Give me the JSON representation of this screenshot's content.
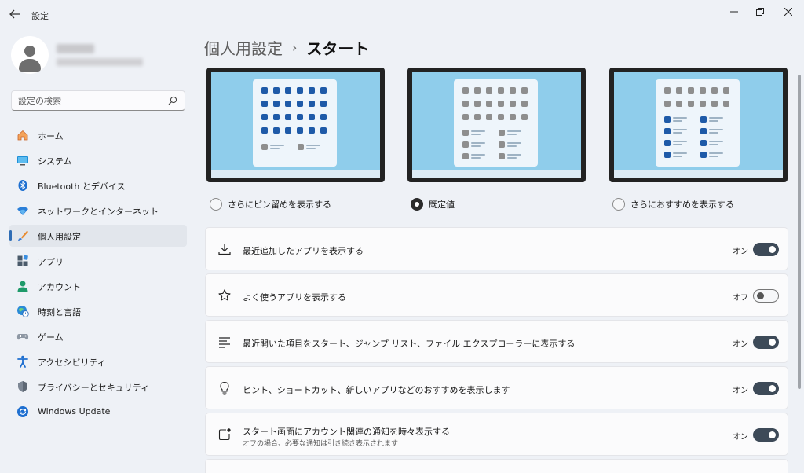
{
  "window": {
    "title": "設定",
    "controls": {
      "minimize": "—",
      "maximize": "❐",
      "close": "✕"
    }
  },
  "sidebar": {
    "search_placeholder": "設定の検索",
    "items": [
      {
        "label": "ホーム",
        "icon": "home-icon",
        "active": false
      },
      {
        "label": "システム",
        "icon": "system-icon",
        "active": false
      },
      {
        "label": "Bluetooth とデバイス",
        "icon": "bluetooth-icon",
        "active": false
      },
      {
        "label": "ネットワークとインターネット",
        "icon": "wifi-icon",
        "active": false
      },
      {
        "label": "個人用設定",
        "icon": "brush-icon",
        "active": true
      },
      {
        "label": "アプリ",
        "icon": "apps-icon",
        "active": false
      },
      {
        "label": "アカウント",
        "icon": "account-icon",
        "active": false
      },
      {
        "label": "時刻と言語",
        "icon": "globe-clock-icon",
        "active": false
      },
      {
        "label": "ゲーム",
        "icon": "gamepad-icon",
        "active": false
      },
      {
        "label": "アクセシビリティ",
        "icon": "accessibility-icon",
        "active": false
      },
      {
        "label": "プライバシーとセキュリティ",
        "icon": "shield-icon",
        "active": false
      },
      {
        "label": "Windows Update",
        "icon": "update-icon",
        "active": false
      }
    ]
  },
  "main": {
    "breadcrumb": {
      "parent": "個人用設定",
      "separator": "›",
      "current": "スタート"
    },
    "layout_options": [
      {
        "label": "さらにピン留めを表示する",
        "selected": false
      },
      {
        "label": "既定値",
        "selected": true
      },
      {
        "label": "さらにおすすめを表示する",
        "selected": false
      }
    ],
    "settings": [
      {
        "title": "最近追加したアプリを表示する",
        "subtitle": "",
        "state": "オン",
        "on": true,
        "icon": "download-icon"
      },
      {
        "title": "よく使うアプリを表示する",
        "subtitle": "",
        "state": "オフ",
        "on": false,
        "icon": "star-icon"
      },
      {
        "title": "最近開いた項目をスタート、ジャンプ リスト、ファイル エクスプローラーに表示する",
        "subtitle": "",
        "state": "オン",
        "on": true,
        "icon": "list-icon"
      },
      {
        "title": "ヒント、ショートカット、新しいアプリなどのおすすめを表示します",
        "subtitle": "",
        "state": "オン",
        "on": true,
        "icon": "lightbulb-icon"
      },
      {
        "title": "スタート画面にアカウント関連の通知を時々表示する",
        "subtitle": "オフの場合、必要な通知は引き続き表示されます",
        "state": "オン",
        "on": true,
        "icon": "notification-icon"
      }
    ]
  },
  "colors": {
    "accent": "#2f6db5",
    "toggle_on": "#3d4a58",
    "preview_bg": "#8fcdeb",
    "tile_gray": "#8e8e8e",
    "tile_blue": "#1e5aa8"
  }
}
